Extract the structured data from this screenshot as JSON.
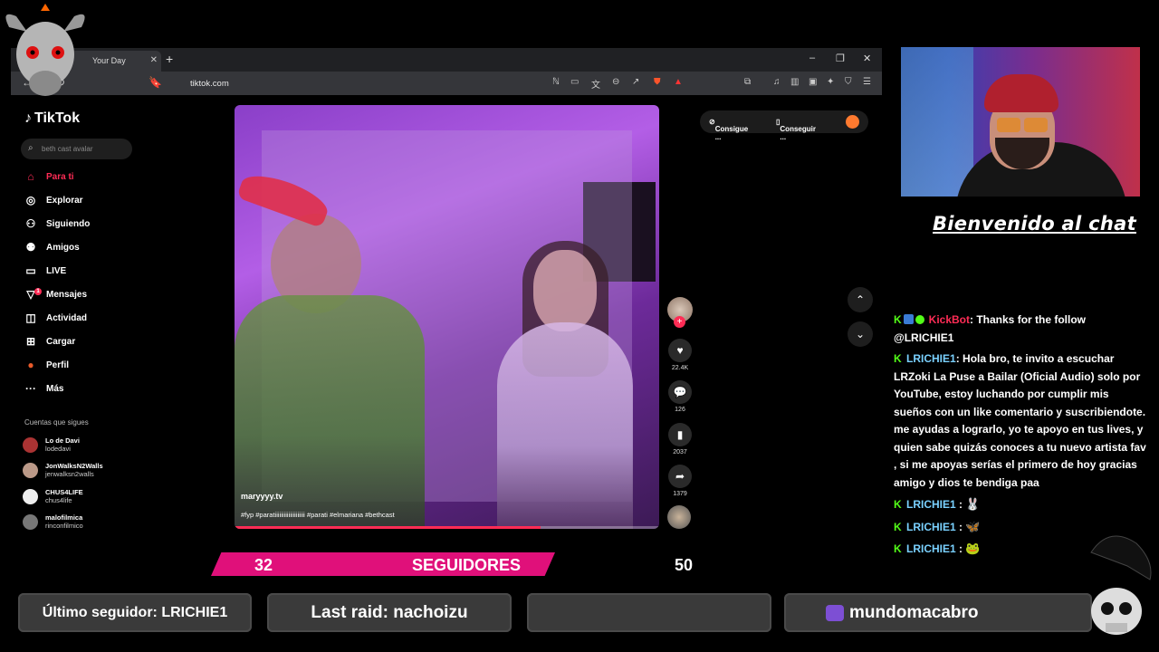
{
  "browser": {
    "tab_title": "Your Day",
    "new_tab_icon": "+",
    "url": "tiktok.com",
    "window_controls": [
      "–",
      "❐",
      "✕"
    ]
  },
  "tiktok": {
    "logo": "TikTok",
    "search_placeholder": "beth cast avalar",
    "menu": [
      {
        "label": "Para ti",
        "icon": "home-icon",
        "active": true
      },
      {
        "label": "Explorar",
        "icon": "compass-icon"
      },
      {
        "label": "Siguiendo",
        "icon": "following-icon"
      },
      {
        "label": "Amigos",
        "icon": "friends-icon"
      },
      {
        "label": "LIVE",
        "icon": "live-icon"
      },
      {
        "label": "Mensajes",
        "icon": "messages-icon",
        "badge": "1"
      },
      {
        "label": "Actividad",
        "icon": "activity-icon"
      },
      {
        "label": "Cargar",
        "icon": "upload-icon"
      },
      {
        "label": "Perfil",
        "icon": "profile-icon"
      },
      {
        "label": "Más",
        "icon": "more-icon"
      }
    ],
    "follows_title": "Cuentas que sigues",
    "follows": [
      {
        "name": "Lo de Davi",
        "handle": "lodedavi",
        "color": "#a33"
      },
      {
        "name": "JonWalksN2Walls",
        "handle": "jenwalksn2walls",
        "color": "#b98"
      },
      {
        "name": "CHUS4LIFE",
        "handle": "chus4life",
        "color": "#eee"
      },
      {
        "name": "malofilmica",
        "handle": "rinconfilmico",
        "color": "#777"
      }
    ],
    "video": {
      "username": "maryyyy.tv",
      "caption": "#fyp #paratiiiiiiiiiiiiiiiiiiii #parati #elmariana #bethcast",
      "progress": 0.72
    },
    "actions": {
      "likes": "22.4K",
      "comments": "126",
      "saves": "2037",
      "shares": "1379"
    },
    "top_actions": {
      "a": "Consigue ...",
      "b": "Conseguir ..."
    }
  },
  "stream": {
    "welcome": "Bienvenido al chat",
    "chat": [
      {
        "user": "KickBot",
        "type": "bot",
        "text": ": Thanks for the follow @LRICHIE1"
      },
      {
        "user": "LRICHIE1",
        "type": "user",
        "text": ": Hola bro, te invito a escuchar LRZoki La Puse a Bailar (Oficial Audio) solo por YouTube, estoy luchando por cumplir mis sueños con un like comentario y suscribiendote. me ayudas a lograrlo, yo te apoyo en tus lives, y quien sabe quizás conoces a tu nuevo artista fav , si me apoyas serías el primero de hoy gracias amigo y dios te bendiga paa"
      },
      {
        "user": "LRICHIE1",
        "type": "user",
        "text": " : ",
        "emote": "🐰"
      },
      {
        "user": "LRICHIE1",
        "type": "user",
        "text": " : ",
        "emote": "🦋"
      },
      {
        "user": "LRICHIE1",
        "type": "user",
        "text": " : ",
        "emote": "🐸"
      }
    ],
    "followers_goal": {
      "current": "32",
      "label": "SEGUIDORES",
      "goal": "50"
    },
    "bottom": {
      "last_follower": "Último seguidor: LRICHIE1",
      "last_raid": "Last raid: nachoizu",
      "empty": "",
      "channel": "mundomacabro"
    }
  }
}
